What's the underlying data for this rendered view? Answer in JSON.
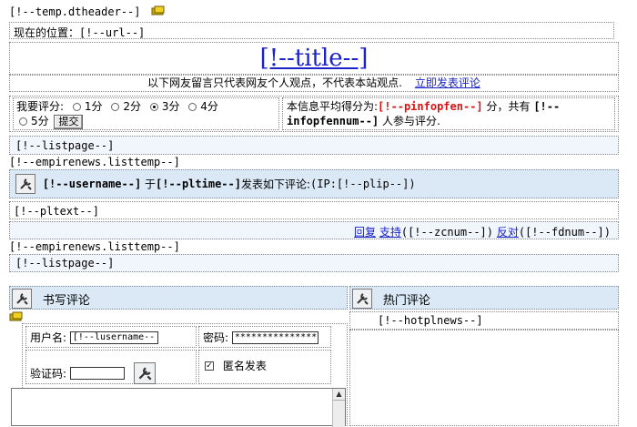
{
  "template": {
    "dtheader": "[!--temp.dtheader--]",
    "position_label": "现在的位置：",
    "url_placeholder": "[!--url--]",
    "title": "[!--title--]",
    "disclaimer": "以下网友留言只代表网友个人观点，不代表本站观点.",
    "comment_now_link": "立即发表评论"
  },
  "rating": {
    "label": "我要评分:",
    "options": [
      "1分",
      "2分",
      "3分",
      "4分",
      "5分"
    ],
    "selected": "3分",
    "submit_label": "提交",
    "avg_prefix": "本信息平均得分为:",
    "avg_value": "[!--pinfopfen--]",
    "avg_mid": "分，共有",
    "count_value": "[!--infopfennum--]",
    "count_suffix": "人参与评分."
  },
  "listpage_top": "[!--listpage--]",
  "listtemp_open": "[!--empirenews.listtemp--]",
  "comment": {
    "username": "[!--username--]",
    "at": "于",
    "pltime": "[!--pltime--]",
    "said": "发表如下评论:",
    "ip_text": "(IP:[!--plip--])",
    "pltext": "[!--pltext--]",
    "reply_link": "回复",
    "support_link": "支持",
    "zcnum": "([!--zcnum--])",
    "oppose_link": "反对",
    "fdnum": "([!--fdnum--])"
  },
  "listtemp_close": "[!--empirenews.listtemp--]",
  "listpage_bottom": "[!--listpage--]",
  "write_section": {
    "title": "书写评论",
    "username_label": "用户名:",
    "username_value": "[!--lusername--",
    "password_label": "密码:",
    "password_value": "***************",
    "captcha_label": "验证码:",
    "anonymous_label": "匿名发表",
    "anonymous_checked": true
  },
  "hot_section": {
    "title": "热门评论",
    "hotplnews": "[!--hotplnews--]"
  },
  "colors": {
    "link": "#1a22c8",
    "highlight_red": "#e01010",
    "header_bg": "#dbe9f6",
    "row_bg": "#f0f6fc"
  }
}
